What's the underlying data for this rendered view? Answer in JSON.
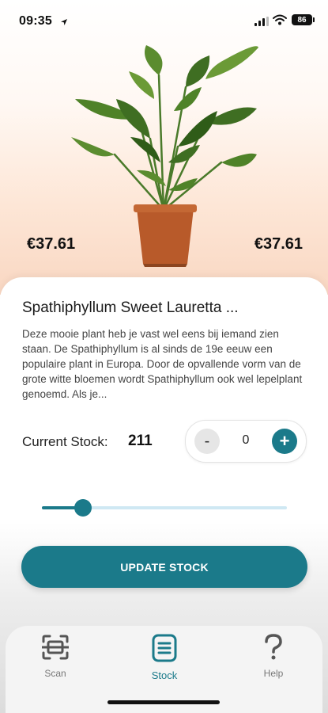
{
  "status_bar": {
    "time": "09:35",
    "battery": "86"
  },
  "product": {
    "image": "plant-image",
    "price_left": "€37.61",
    "price_right": "€37.61",
    "title": "Spathiphyllum Sweet Lauretta ...",
    "description": "Deze mooie plant heb je vast wel eens bij iemand zien staan. De Spathiphyllum is al sinds de 19e eeuw een populaire plant in Europa. Door de opvallende vorm van de grote witte bloemen wordt Spathiphyllum ook wel lepelplant genoemd. Als je..."
  },
  "stock": {
    "label": "Current Stock:",
    "value": "211",
    "stepper_value": "0",
    "minus_symbol": "-",
    "plus_symbol": "+",
    "slider_level_fraction": 0.14
  },
  "actions": {
    "update_label": "UPDATE STOCK"
  },
  "tabbar": {
    "tabs": [
      {
        "label": "Scan",
        "icon": "scan-icon",
        "active": false
      },
      {
        "label": "Stock",
        "icon": "stock-list-icon",
        "active": true
      },
      {
        "label": "Help",
        "icon": "question-icon",
        "active": false
      }
    ]
  },
  "colors": {
    "accent": "#1b7a8a",
    "slider_track": "#cfe8f3",
    "hero_gradient_bottom": "#f9d7c2"
  }
}
